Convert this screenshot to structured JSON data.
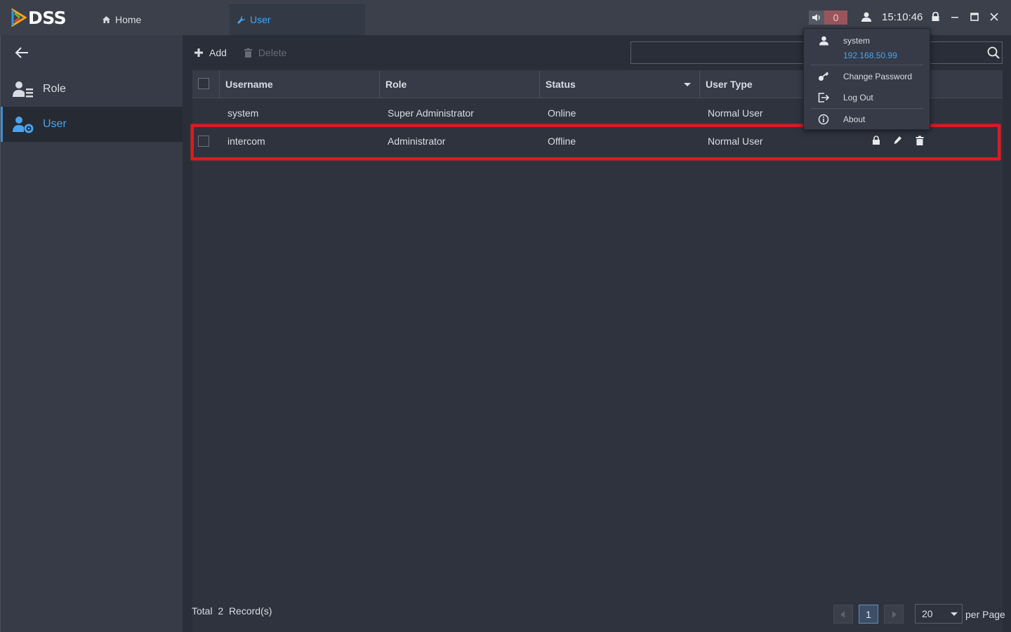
{
  "app": {
    "logo_text": "DSS",
    "tabs": [
      {
        "label": "Home",
        "icon": "home-icon"
      },
      {
        "label": "User",
        "icon": "wrench-icon"
      }
    ]
  },
  "topbar": {
    "alarm_count": "0",
    "clock": "15:10:46"
  },
  "sidebar": {
    "items": [
      {
        "label": "Role",
        "icon": "role-icon"
      },
      {
        "label": "User",
        "icon": "user-settings-icon"
      }
    ]
  },
  "toolbar": {
    "add_label": "Add",
    "delete_label": "Delete"
  },
  "search": {
    "value": ""
  },
  "table": {
    "headers": [
      "Username",
      "Role",
      "Status",
      "User Type"
    ],
    "rows": [
      {
        "username": "system",
        "role": "Super Administrator",
        "status": "Online",
        "user_type": "Normal User"
      },
      {
        "username": "intercom",
        "role": "Administrator",
        "status": "Offline",
        "user_type": "Normal User"
      }
    ]
  },
  "user_menu": {
    "username": "system",
    "ip": "192.168.50.99",
    "change_password": "Change Password",
    "log_out": "Log Out",
    "about": "About"
  },
  "footer": {
    "total_label": "Total",
    "total_count": "2",
    "records_label": "Record(s)",
    "current_page": "1",
    "page_size": "20",
    "per_page_label": "per Page"
  },
  "colors": {
    "accent": "#4aa3ea",
    "highlight": "#e0191e",
    "alarm": "#9a555c"
  }
}
